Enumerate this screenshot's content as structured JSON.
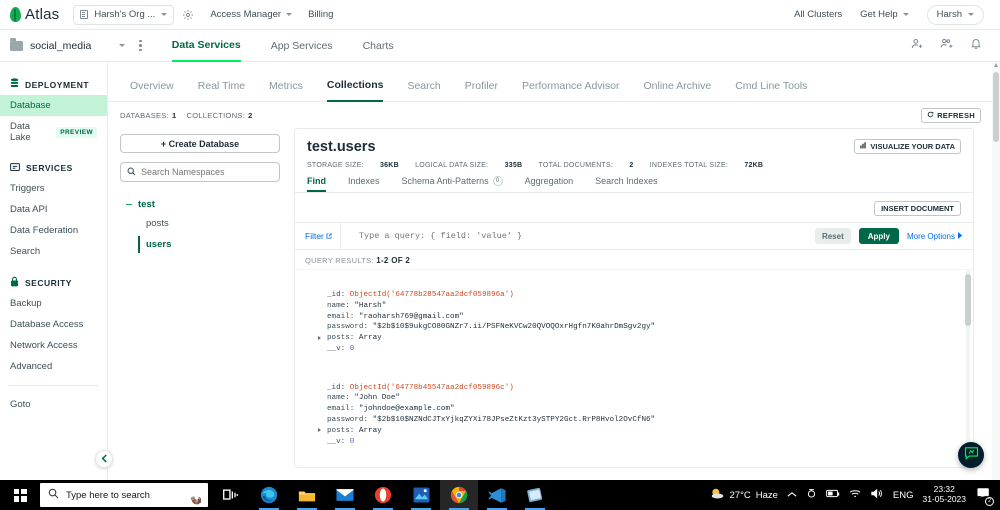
{
  "org_bar": {
    "brand": "Atlas",
    "org_name": "Harsh's Org ...",
    "access_manager": "Access Manager",
    "billing": "Billing",
    "all_clusters": "All Clusters",
    "get_help": "Get Help",
    "user": "Harsh",
    "icons": [
      "org-icon",
      "gear-icon",
      "chevron-down-icon"
    ]
  },
  "project_bar": {
    "project_name": "social_media",
    "tabs": [
      {
        "label": "Data Services",
        "active": true
      },
      {
        "label": "App Services",
        "active": false
      },
      {
        "label": "Charts",
        "active": false
      }
    ],
    "right_icons": [
      "invite-user-icon",
      "manage-teams-icon",
      "bell-icon"
    ]
  },
  "sidebar": {
    "groups": [
      {
        "title": "DEPLOYMENT",
        "icon": "database-stack-icon",
        "items": [
          {
            "label": "Database",
            "active": true,
            "badge": ""
          },
          {
            "label": "Data Lake",
            "active": false,
            "badge": "PREVIEW"
          }
        ]
      },
      {
        "title": "SERVICES",
        "icon": "services-icon",
        "items": [
          {
            "label": "Triggers",
            "active": false,
            "badge": ""
          },
          {
            "label": "Data API",
            "active": false,
            "badge": ""
          },
          {
            "label": "Data Federation",
            "active": false,
            "badge": ""
          },
          {
            "label": "Search",
            "active": false,
            "badge": ""
          }
        ]
      },
      {
        "title": "SECURITY",
        "icon": "lock-icon",
        "items": [
          {
            "label": "Backup",
            "active": false,
            "badge": ""
          },
          {
            "label": "Database Access",
            "active": false,
            "badge": ""
          },
          {
            "label": "Network Access",
            "active": false,
            "badge": ""
          },
          {
            "label": "Advanced",
            "active": false,
            "badge": ""
          }
        ]
      }
    ],
    "goto": "Goto",
    "collapse_icon": "chevron-left-icon"
  },
  "cluster_tabs": [
    {
      "label": "Overview",
      "active": false
    },
    {
      "label": "Real Time",
      "active": false
    },
    {
      "label": "Metrics",
      "active": false
    },
    {
      "label": "Collections",
      "active": true
    },
    {
      "label": "Search",
      "active": false
    },
    {
      "label": "Profiler",
      "active": false
    },
    {
      "label": "Performance Advisor",
      "active": false
    },
    {
      "label": "Online Archive",
      "active": false
    },
    {
      "label": "Cmd Line Tools",
      "active": false
    }
  ],
  "db_stats": {
    "databases_label": "DATABASES:",
    "databases_value": "1",
    "collections_label": "COLLECTIONS:",
    "collections_value": "2",
    "refresh_label": "REFRESH",
    "refresh_icon": "refresh-icon"
  },
  "namespaces": {
    "create_database": "+ Create Database",
    "search_placeholder": "Search Namespaces",
    "search_value": "",
    "search_icon": "search-icon",
    "database": "test",
    "collections": [
      {
        "label": "posts",
        "active": false
      },
      {
        "label": "users",
        "active": true
      }
    ]
  },
  "collection": {
    "title": "test.users",
    "visualize_label": "VISUALIZE YOUR DATA",
    "visualize_icon": "chart-bar-icon",
    "stats": [
      {
        "label": "STORAGE SIZE:",
        "value": "36KB"
      },
      {
        "label": "LOGICAL DATA SIZE:",
        "value": "335B"
      },
      {
        "label": "TOTAL DOCUMENTS:",
        "value": "2"
      },
      {
        "label": "INDEXES TOTAL SIZE:",
        "value": "72KB"
      }
    ],
    "tabs": [
      {
        "label": "Find",
        "active": true,
        "count": ""
      },
      {
        "label": "Indexes",
        "active": false,
        "count": ""
      },
      {
        "label": "Schema Anti-Patterns",
        "active": false,
        "count": "0"
      },
      {
        "label": "Aggregation",
        "active": false,
        "count": ""
      },
      {
        "label": "Search Indexes",
        "active": false,
        "count": ""
      }
    ],
    "insert_document": "INSERT DOCUMENT",
    "filter": {
      "label": "Filter",
      "label_icon": "external-link-icon",
      "placeholder": "Type a query: { field: 'value' }",
      "value": "",
      "reset": "Reset",
      "apply": "Apply",
      "more_options": "More Options",
      "more_options_icon": "chevron-right-icon"
    },
    "query_results_label": "QUERY RESULTS:",
    "query_results_value": "1-2 OF 2",
    "documents": [
      {
        "id_key": "_id:",
        "id_value": "ObjectId('64778b28547aa2dcf059896a')",
        "fields": [
          {
            "key": "name:",
            "value": "\"Harsh\"",
            "type": "string"
          },
          {
            "key": "email:",
            "value": "\"raoharsh769@gmail.com\"",
            "type": "string"
          },
          {
            "key": "password:",
            "value": "\"$2b$10$9ukgCO80GNZr7.ii/PSFNeKVCw20QVOQOxrHgfn7K0ahrDmSgv2gy\"",
            "type": "string"
          },
          {
            "key": "posts:",
            "value": "Array",
            "type": "array"
          },
          {
            "key": "__v:",
            "value": "0",
            "type": "number"
          }
        ]
      },
      {
        "id_key": "_id:",
        "id_value": "ObjectId('64778b45547aa2dcf059896c')",
        "fields": [
          {
            "key": "name:",
            "value": "\"John Doe\"",
            "type": "string"
          },
          {
            "key": "email:",
            "value": "\"johndoe@example.com\"",
            "type": "string"
          },
          {
            "key": "password:",
            "value": "\"$2b$10$NZNdCJTxYjkqZYXi78JPseZtKzt3ySTPY2Gct.RrP8Hvol2OvCfN6\"",
            "type": "string"
          },
          {
            "key": "posts:",
            "value": "Array",
            "type": "array"
          },
          {
            "key": "__v:",
            "value": "0",
            "type": "number"
          }
        ]
      }
    ],
    "chat_fab_icon": "chat-bubble-icon"
  },
  "taskbar": {
    "start_icon": "windows-start-icon",
    "search_placeholder": "Type here to search",
    "search_icon": "search-icon",
    "otter_icon": "otter-icon",
    "apps": [
      {
        "name": "task-view-icon",
        "running": false
      },
      {
        "name": "edge-icon",
        "running": true
      },
      {
        "name": "file-explorer-icon",
        "running": true
      },
      {
        "name": "mail-icon",
        "running": true
      },
      {
        "name": "opera-icon",
        "running": true
      },
      {
        "name": "photos-icon",
        "running": true
      },
      {
        "name": "chrome-icon",
        "running": true,
        "active": true
      },
      {
        "name": "vscode-icon",
        "running": true
      },
      {
        "name": "postman-icon",
        "running": true
      }
    ],
    "tray": {
      "weather_icon": "partly-cloudy-icon",
      "temperature": "27°C",
      "condition": "Haze",
      "chevron_icon": "chevron-up-icon",
      "icons": [
        "camera-icon",
        "battery-icon",
        "wifi-icon",
        "volume-icon"
      ],
      "language": "ENG",
      "time": "23:32",
      "date": "31-05-2023",
      "notification_icon": "notification-icon",
      "notification_count": "2"
    }
  },
  "colors": {
    "brand_green": "#13aa52",
    "dark_green": "#00684a",
    "accent_green": "#00ed64",
    "link_blue": "#016bf8",
    "oid_red": "#cf4a22",
    "num_purple": "#5b6dcd"
  }
}
